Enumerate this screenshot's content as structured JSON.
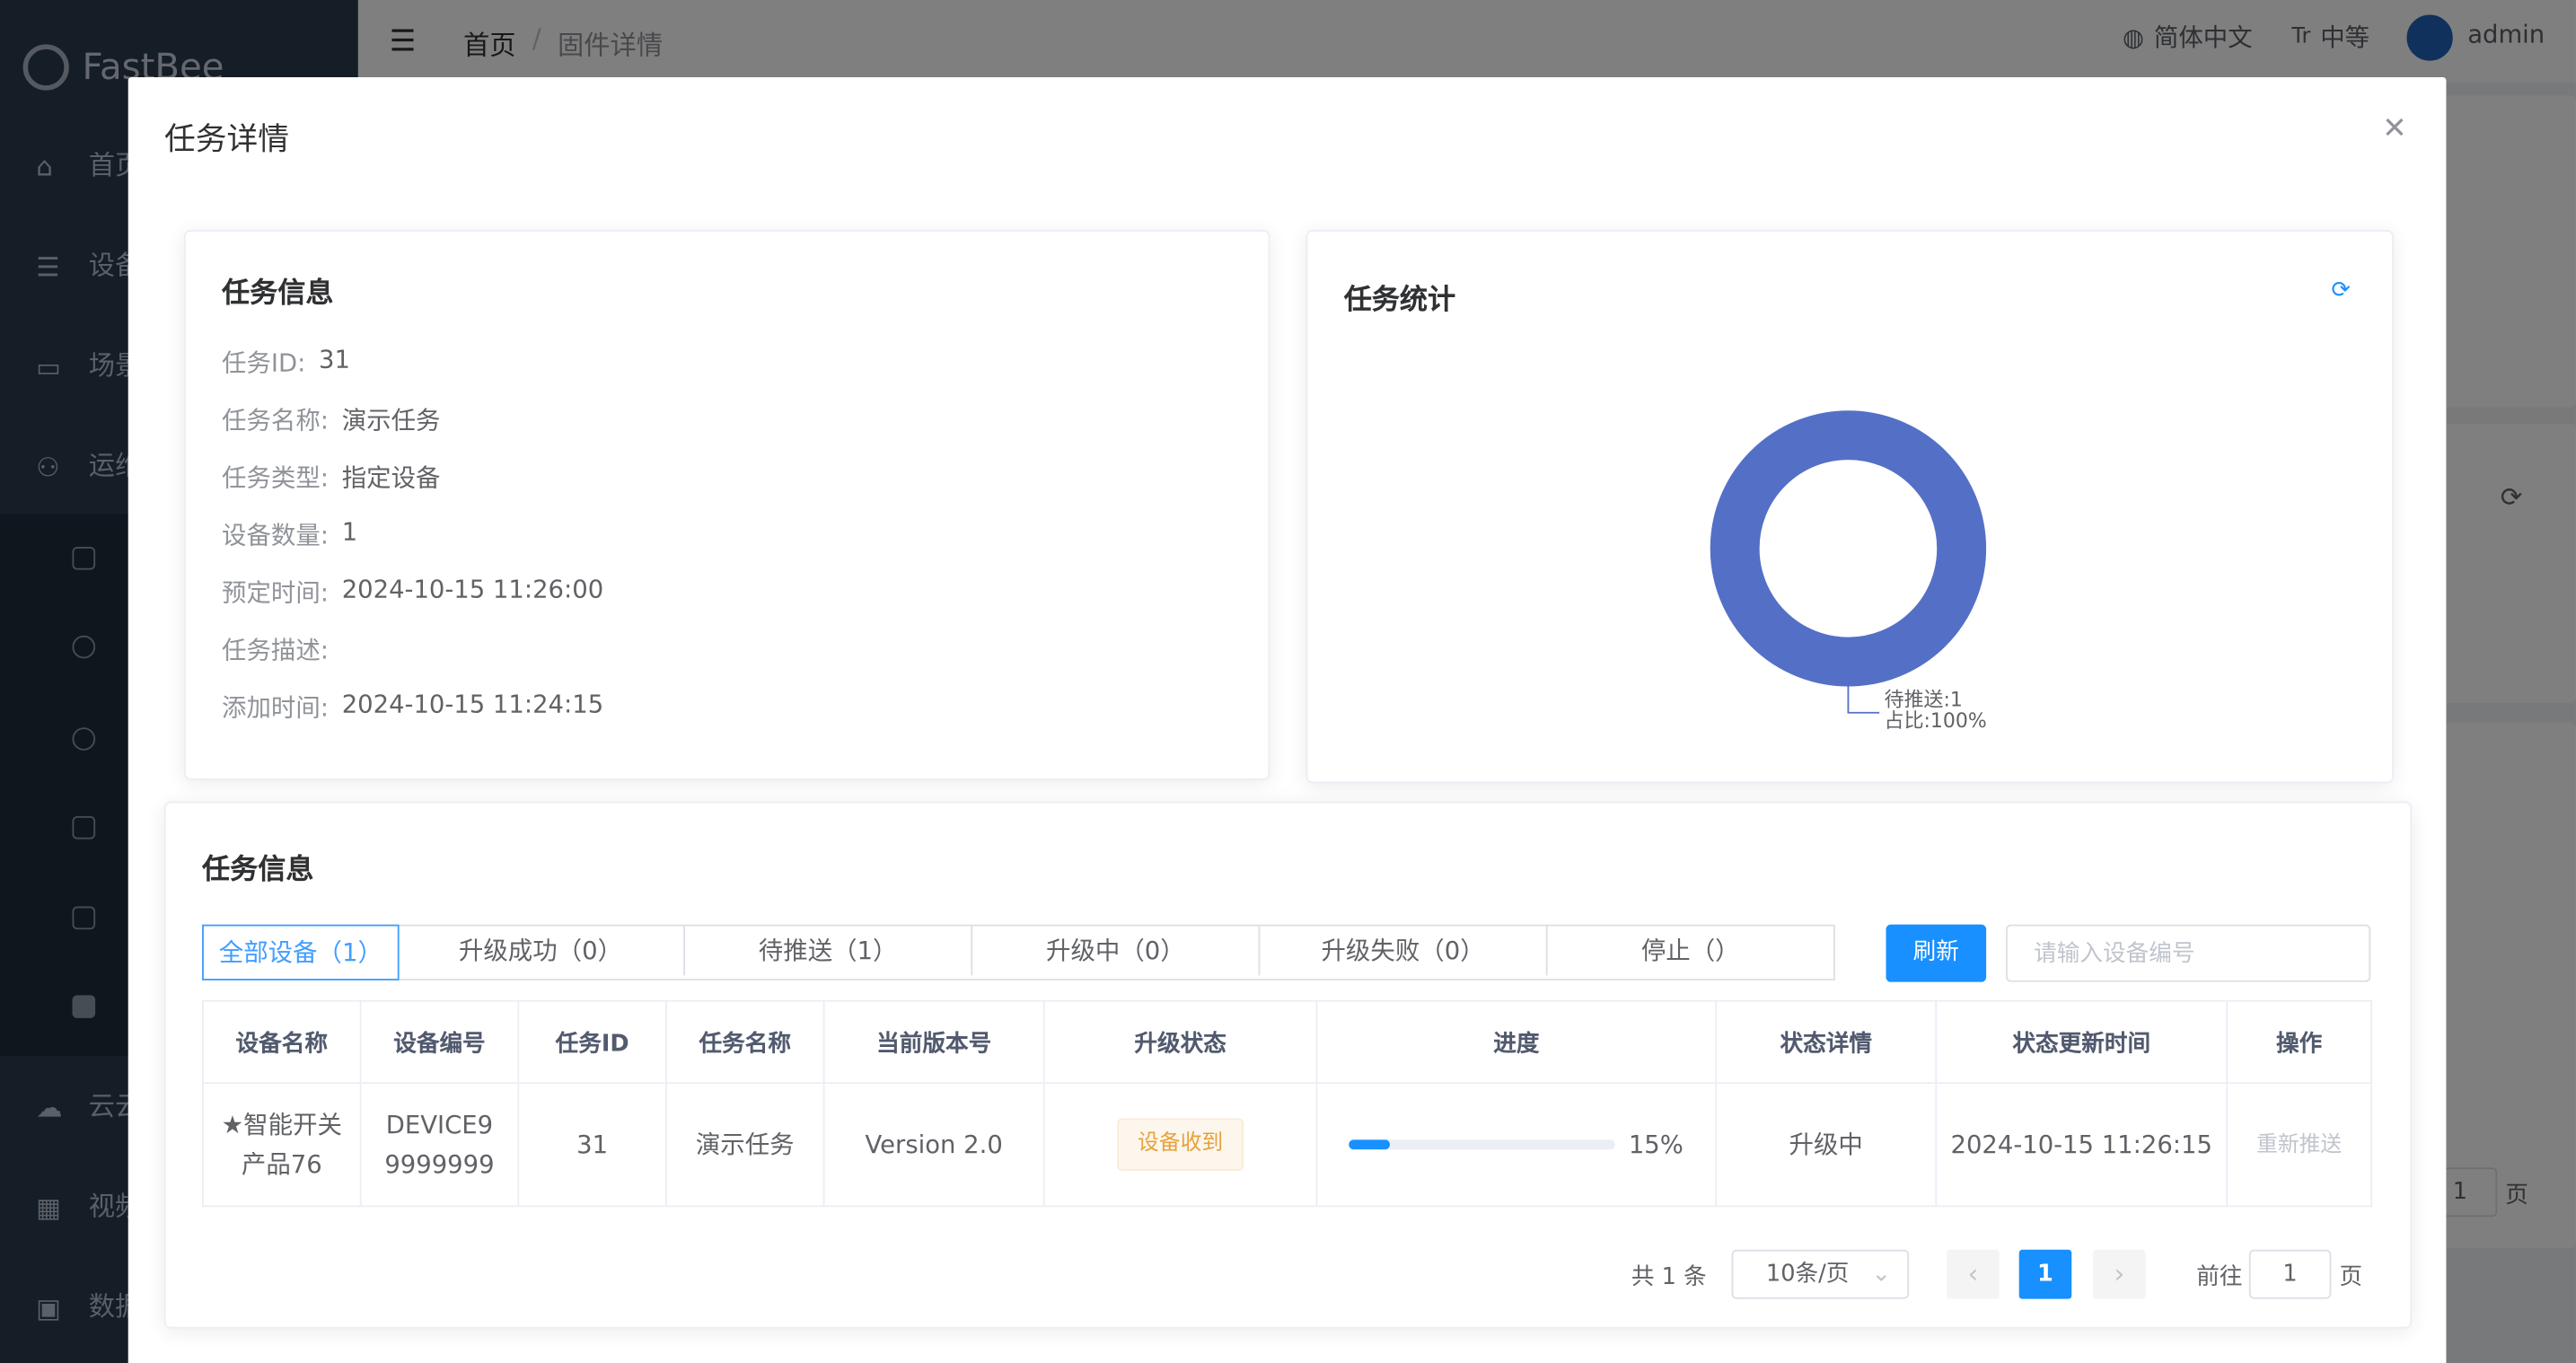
{
  "app": {
    "logo": "FastBee"
  },
  "sidebar": {
    "items": [
      {
        "label": "首页",
        "icon": "home-icon"
      },
      {
        "label": "设备",
        "icon": "device-icon"
      },
      {
        "label": "场景",
        "icon": "scene-icon"
      },
      {
        "label": "运维",
        "icon": "ops-icon"
      },
      {
        "label": "云云",
        "icon": "cloud-icon"
      },
      {
        "label": "视频",
        "icon": "video-icon"
      },
      {
        "label": "数据",
        "icon": "data-icon"
      }
    ]
  },
  "header": {
    "breadcrumb": [
      "首页",
      "固件详情"
    ],
    "language": "简体中文",
    "font_size": "中等",
    "user": "admin"
  },
  "background": {
    "jump_page": "1",
    "page_suffix": "页"
  },
  "modal": {
    "title": "任务详情",
    "info_card": {
      "title": "任务信息",
      "rows": [
        {
          "label": "任务ID:",
          "value": "31"
        },
        {
          "label": "任务名称:",
          "value": "演示任务"
        },
        {
          "label": "任务类型:",
          "value": "指定设备"
        },
        {
          "label": "设备数量:",
          "value": "1"
        },
        {
          "label": "预定时间:",
          "value": "2024-10-15 11:26:00"
        },
        {
          "label": "任务描述:",
          "value": ""
        },
        {
          "label": "添加时间:",
          "value": "2024-10-15 11:24:15"
        }
      ]
    },
    "stats_card": {
      "title": "任务统计"
    },
    "chart_data": {
      "type": "pie",
      "donut": true,
      "slices": [
        {
          "name": "待推送",
          "value": 1,
          "percent": 100,
          "color": "#5470c6"
        }
      ],
      "label_lines": [
        "待推送:1",
        "占比:100%"
      ],
      "legend": "none"
    },
    "device_card": {
      "title": "任务信息",
      "tabs": [
        "全部设备（1）",
        "升级成功（0）",
        "待推送（1）",
        "升级中（0）",
        "升级失败（0）",
        "停止（）"
      ],
      "active_tab": 0,
      "refresh_label": "刷新",
      "search_placeholder": "请输入设备编号",
      "columns": [
        "设备名称",
        "设备编号",
        "任务ID",
        "任务名称",
        "当前版本号",
        "升级状态",
        "进度",
        "状态详情",
        "状态更新时间",
        "操作"
      ],
      "rows": [
        {
          "device_name": "★智能开关产品76",
          "device_no": "DEVICE99999999",
          "task_id": "31",
          "task_name": "演示任务",
          "version": "Version 2.0",
          "status_tag": "设备收到",
          "progress": 15,
          "progress_text": "15%",
          "detail": "升级中",
          "updated": "2024-10-15 11:26:15",
          "action": "重新推送"
        }
      ],
      "pagination": {
        "total": "共 1 条",
        "page_size": "10条/页",
        "current": "1",
        "goto_label": "前往",
        "goto_value": "1",
        "page_suffix": "页"
      }
    }
  },
  "colors": {
    "accent": "#1890ff",
    "donut": "#5470c6",
    "sidebar": "#2b3a4e"
  }
}
